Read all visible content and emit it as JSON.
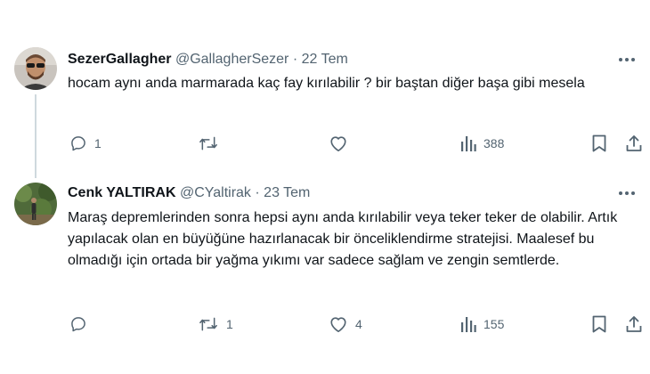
{
  "tweets": [
    {
      "display_name": "SezerGallagher",
      "handle": "@GallagherSezer",
      "separator": "·",
      "date": "22 Tem",
      "text": "hocam aynı anda marmarada kaç fay kırılabilir ? bir baştan diğer başa gibi mesela",
      "reply_count": "1",
      "retweet_count": "",
      "like_count": "",
      "view_count": "388",
      "avatar_icon": "avatar-person-sunglasses"
    },
    {
      "display_name": "Cenk YALTIRAK",
      "handle": "@CYaltirak",
      "separator": "·",
      "date": "23 Tem",
      "text": "Maraş depremlerinden sonra hepsi aynı anda kırılabilir veya teker teker de olabilir.  Artık yapılacak olan en büyüğüne hazırlanacak bir önceliklendirme stratejisi. Maalesef bu olmadığı için ortada bir yağma yıkımı var sadece sağlam ve zengin semtlerde.",
      "reply_count": "",
      "retweet_count": "1",
      "like_count": "4",
      "view_count": "155",
      "avatar_icon": "avatar-person-outdoors"
    }
  ],
  "colors": {
    "text_primary": "#0f1419",
    "text_secondary": "#536471",
    "thread_line": "#cfd9de"
  }
}
